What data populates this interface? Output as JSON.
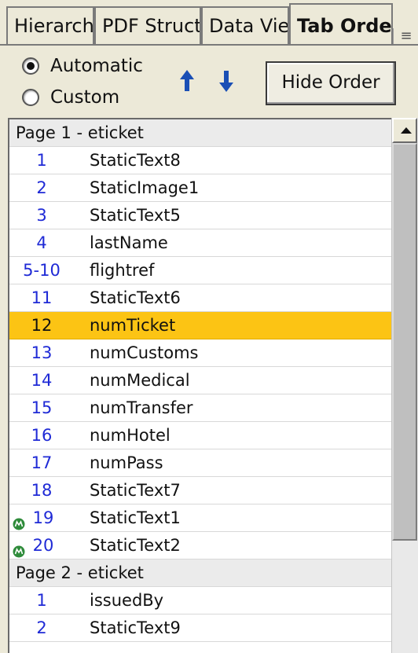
{
  "tabs": [
    {
      "label": "Hierarchy",
      "active": false
    },
    {
      "label": "PDF Structure",
      "active": false
    },
    {
      "label": "Data View",
      "active": false
    },
    {
      "label": "Tab Order",
      "active": true
    }
  ],
  "panel_menu_icon": "panel-menu-icon",
  "order_mode": {
    "options": [
      {
        "label": "Automatic",
        "checked": true
      },
      {
        "label": "Custom",
        "checked": false
      }
    ]
  },
  "move_buttons": {
    "up_icon": "arrow-up-icon",
    "down_icon": "arrow-down-icon",
    "color": "#1a4fb5"
  },
  "hide_order_label": "Hide Order",
  "colors": {
    "selected_row": "#fcc414",
    "tab_number": "#1f2ad6",
    "badge": "#2e8b3a"
  },
  "list": [
    {
      "type": "header",
      "label": "Page 1 - eticket"
    },
    {
      "type": "item",
      "num": "1",
      "name": "StaticText8"
    },
    {
      "type": "item",
      "num": "2",
      "name": "StaticImage1"
    },
    {
      "type": "item",
      "num": "3",
      "name": "StaticText5"
    },
    {
      "type": "item",
      "num": "4",
      "name": "lastName"
    },
    {
      "type": "item",
      "num": "5-10",
      "name": "flightref"
    },
    {
      "type": "item",
      "num": "11",
      "name": "StaticText6"
    },
    {
      "type": "item",
      "num": "12",
      "name": "numTicket",
      "selected": true
    },
    {
      "type": "item",
      "num": "13",
      "name": "numCustoms"
    },
    {
      "type": "item",
      "num": "14",
      "name": "numMedical"
    },
    {
      "type": "item",
      "num": "15",
      "name": "numTransfer"
    },
    {
      "type": "item",
      "num": "16",
      "name": "numHotel"
    },
    {
      "type": "item",
      "num": "17",
      "name": "numPass"
    },
    {
      "type": "item",
      "num": "18",
      "name": "StaticText7"
    },
    {
      "type": "item",
      "num": "19",
      "name": "StaticText1",
      "badge": "script-badge-icon"
    },
    {
      "type": "item",
      "num": "20",
      "name": "StaticText2",
      "badge": "script-badge-icon"
    },
    {
      "type": "header",
      "label": "Page 2 - eticket"
    },
    {
      "type": "item",
      "num": "1",
      "name": "issuedBy"
    },
    {
      "type": "item",
      "num": "2",
      "name": "StaticText9"
    }
  ]
}
